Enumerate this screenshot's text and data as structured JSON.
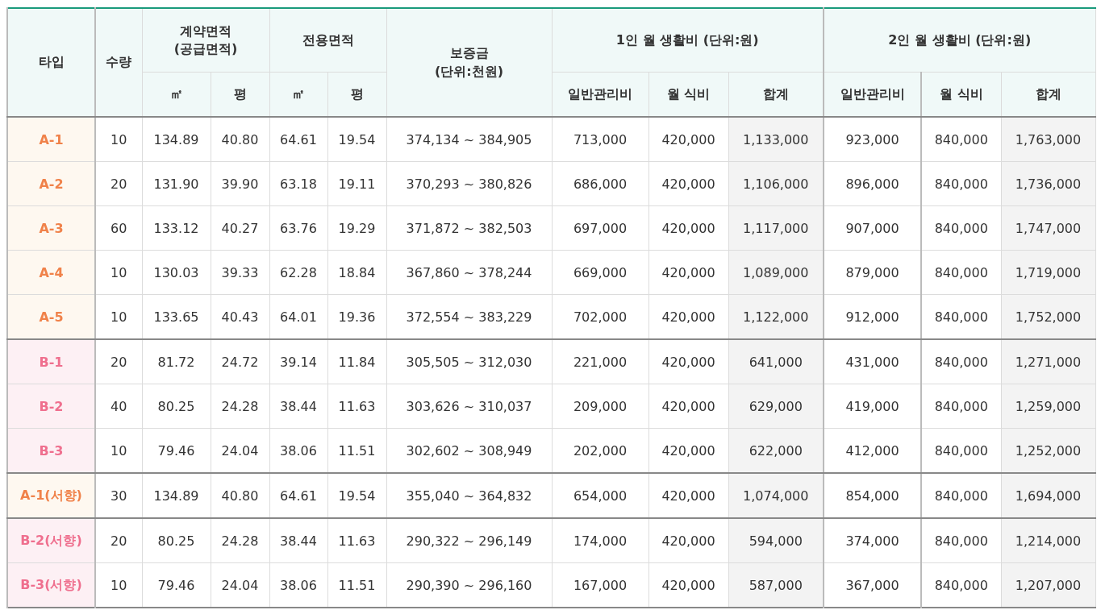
{
  "header": {
    "type": "타입",
    "count": "수량",
    "contract_area": [
      "계약면적",
      "(공급면적)"
    ],
    "exclusive_area": "전용면적",
    "deposit": [
      "보증금",
      "(단위:천원)"
    ],
    "one_person": "1인 월 생활비 (단위:원)",
    "two_person": "2인 월 생활비 (단위:원)",
    "contract_sub": [
      "㎡",
      "평"
    ],
    "exclusive_sub": [
      "㎡",
      "평"
    ],
    "one_sub": [
      "일반관리비",
      "월 식비",
      "합계"
    ],
    "two_sub": [
      "일반관리비",
      "월 식비",
      "합계"
    ]
  },
  "rows": [
    {
      "type": "A-1",
      "kind": "a",
      "count": "10",
      "contract": [
        "134.89",
        "40.80"
      ],
      "exclusive": [
        "64.61",
        "19.54"
      ],
      "deposit": "374,134 ~ 384,905",
      "one": [
        "713,000",
        "420,000",
        "1,133,000"
      ],
      "two": [
        "923,000",
        "840,000",
        "1,763,000"
      ]
    },
    {
      "type": "A-2",
      "kind": "a",
      "count": "20",
      "contract": [
        "131.90",
        "39.90"
      ],
      "exclusive": [
        "63.18",
        "19.11"
      ],
      "deposit": "370,293 ~ 380,826",
      "one": [
        "686,000",
        "420,000",
        "1,106,000"
      ],
      "two": [
        "896,000",
        "840,000",
        "1,736,000"
      ]
    },
    {
      "type": "A-3",
      "kind": "a",
      "count": "60",
      "contract": [
        "133.12",
        "40.27"
      ],
      "exclusive": [
        "63.76",
        "19.29"
      ],
      "deposit": "371,872 ~ 382,503",
      "one": [
        "697,000",
        "420,000",
        "1,117,000"
      ],
      "two": [
        "907,000",
        "840,000",
        "1,747,000"
      ]
    },
    {
      "type": "A-4",
      "kind": "a",
      "count": "10",
      "contract": [
        "130.03",
        "39.33"
      ],
      "exclusive": [
        "62.28",
        "18.84"
      ],
      "deposit": "367,860 ~ 378,244",
      "one": [
        "669,000",
        "420,000",
        "1,089,000"
      ],
      "two": [
        "879,000",
        "840,000",
        "1,719,000"
      ]
    },
    {
      "type": "A-5",
      "kind": "a",
      "count": "10",
      "contract": [
        "133.65",
        "40.43"
      ],
      "exclusive": [
        "64.01",
        "19.36"
      ],
      "deposit": "372,554 ~ 383,229",
      "one": [
        "702,000",
        "420,000",
        "1,122,000"
      ],
      "two": [
        "912,000",
        "840,000",
        "1,752,000"
      ]
    },
    {
      "type": "B-1",
      "kind": "b",
      "count": "20",
      "contract": [
        "81.72",
        "24.72"
      ],
      "exclusive": [
        "39.14",
        "11.84"
      ],
      "deposit": "305,505 ~ 312,030",
      "one": [
        "221,000",
        "420,000",
        "641,000"
      ],
      "two": [
        "431,000",
        "840,000",
        "1,271,000"
      ]
    },
    {
      "type": "B-2",
      "kind": "b",
      "count": "40",
      "contract": [
        "80.25",
        "24.28"
      ],
      "exclusive": [
        "38.44",
        "11.63"
      ],
      "deposit": "303,626 ~ 310,037",
      "one": [
        "209,000",
        "420,000",
        "629,000"
      ],
      "two": [
        "419,000",
        "840,000",
        "1,259,000"
      ]
    },
    {
      "type": "B-3",
      "kind": "b",
      "count": "10",
      "contract": [
        "79.46",
        "24.04"
      ],
      "exclusive": [
        "38.06",
        "11.51"
      ],
      "deposit": "302,602 ~ 308,949",
      "one": [
        "202,000",
        "420,000",
        "622,000"
      ],
      "two": [
        "412,000",
        "840,000",
        "1,252,000"
      ]
    },
    {
      "type": "A-1(서향)",
      "kind": "a",
      "count": "30",
      "contract": [
        "134.89",
        "40.80"
      ],
      "exclusive": [
        "64.61",
        "19.54"
      ],
      "deposit": "355,040 ~ 364,832",
      "one": [
        "654,000",
        "420,000",
        "1,074,000"
      ],
      "two": [
        "854,000",
        "840,000",
        "1,694,000"
      ]
    },
    {
      "type": "B-2(서향)",
      "kind": "b",
      "count": "20",
      "contract": [
        "80.25",
        "24.28"
      ],
      "exclusive": [
        "38.44",
        "11.63"
      ],
      "deposit": "290,322 ~ 296,149",
      "one": [
        "174,000",
        "420,000",
        "594,000"
      ],
      "two": [
        "374,000",
        "840,000",
        "1,214,000"
      ]
    },
    {
      "type": "B-3(서향)",
      "kind": "b",
      "count": "10",
      "contract": [
        "79.46",
        "24.04"
      ],
      "exclusive": [
        "38.06",
        "11.51"
      ],
      "deposit": "290,390 ~ 296,160",
      "one": [
        "167,000",
        "420,000",
        "587,000"
      ],
      "two": [
        "367,000",
        "840,000",
        "1,207,000"
      ]
    }
  ]
}
